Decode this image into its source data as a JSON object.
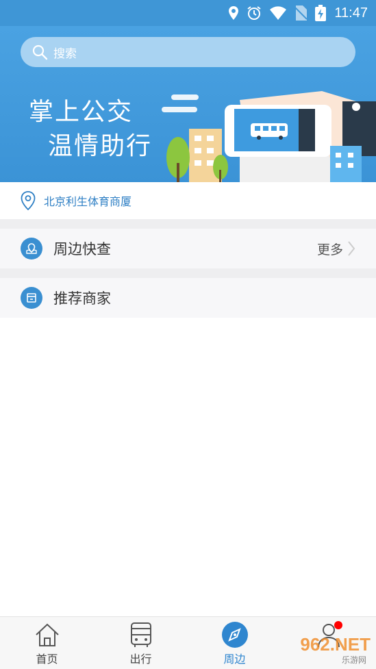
{
  "status_bar": {
    "time": "11:47"
  },
  "search": {
    "placeholder": "搜索"
  },
  "banner": {
    "line1": "掌上公交",
    "line2": "温情助行"
  },
  "location": {
    "text": "北京利生体育商厦"
  },
  "sections": {
    "nearby": {
      "label": "周边快查",
      "more_label": "更多"
    },
    "recommended": {
      "label": "推荐商家"
    }
  },
  "tabbar": {
    "tabs": [
      {
        "label": "首页",
        "icon": "home-icon"
      },
      {
        "label": "出行",
        "icon": "bus-icon"
      },
      {
        "label": "周边",
        "icon": "compass-icon",
        "active": true
      },
      {
        "label": "",
        "icon": "profile-icon"
      }
    ]
  },
  "watermark": {
    "text": "962.NET",
    "sub": "乐游网"
  },
  "colors": {
    "primary": "#3f96d6",
    "accent_text": "#2e7fc4",
    "notification": "#ff0000"
  }
}
